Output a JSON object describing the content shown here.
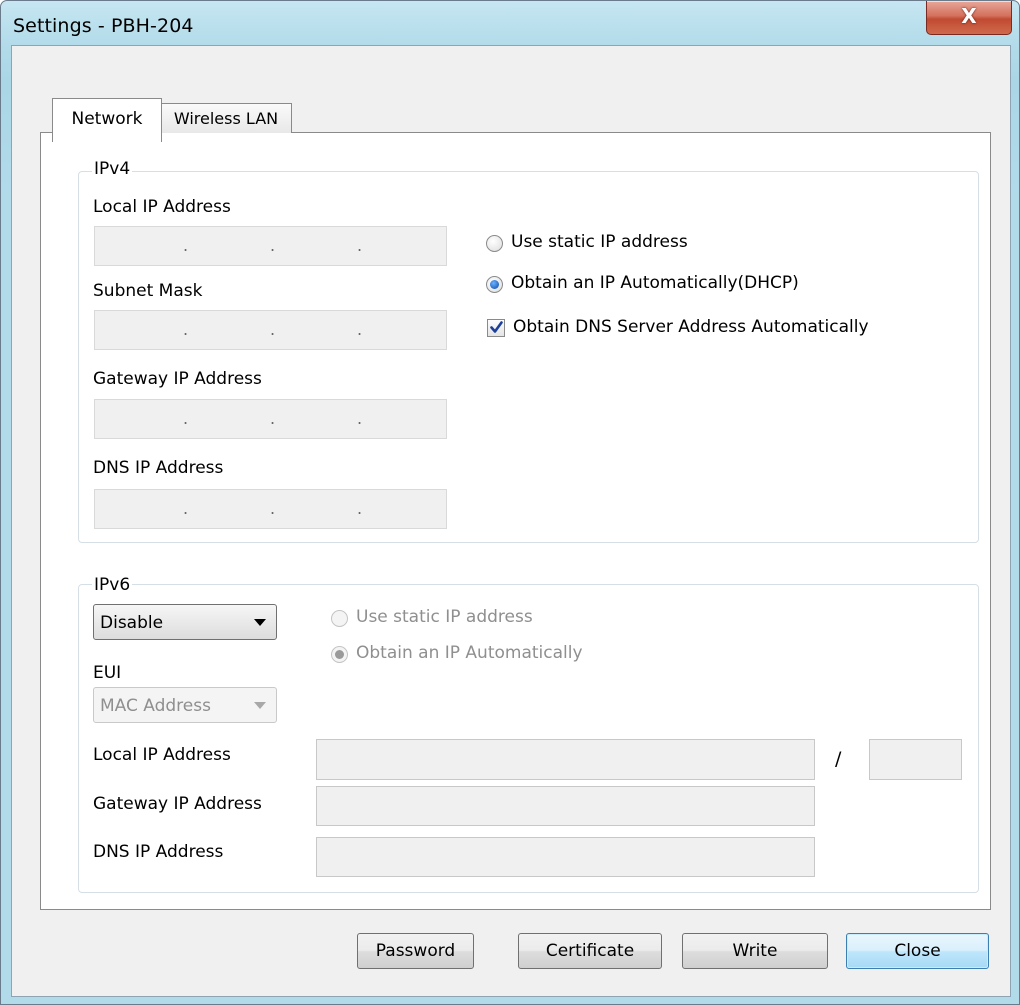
{
  "window": {
    "title": "Settings - PBH-204",
    "close_glyph": "X"
  },
  "tabs": [
    {
      "label": "Network",
      "active": true
    },
    {
      "label": "Wireless LAN",
      "active": false
    }
  ],
  "ipv4": {
    "group_label": "IPv4",
    "local_ip_label": "Local IP Address",
    "subnet_mask_label": "Subnet Mask",
    "gateway_label": "Gateway IP Address",
    "dns_label": "DNS IP Address",
    "ip_separator": ".",
    "use_static_label": "Use static IP address",
    "obtain_auto_label": "Obtain an IP Automatically(DHCP)",
    "obtain_dns_label": "Obtain DNS Server Address Automatically",
    "use_static_selected": false,
    "obtain_auto_selected": true,
    "obtain_dns_checked": true
  },
  "ipv6": {
    "group_label": "IPv6",
    "mode_value": "Disable",
    "eui_label": "EUI",
    "eui_value": "MAC Address",
    "use_static_label": "Use static IP address",
    "obtain_auto_label": "Obtain an IP Automatically",
    "use_static_selected": false,
    "obtain_auto_selected": true,
    "local_ip_label": "Local IP Address",
    "prefix_separator": "/",
    "gateway_label": "Gateway IP Address",
    "dns_label": "DNS IP Address"
  },
  "buttons": {
    "password": "Password",
    "certificate": "Certificate",
    "write": "Write",
    "close": "Close"
  },
  "icons": {
    "close": "close-icon",
    "checkmark": "checkmark-icon",
    "dropdown": "chevron-down-icon"
  }
}
